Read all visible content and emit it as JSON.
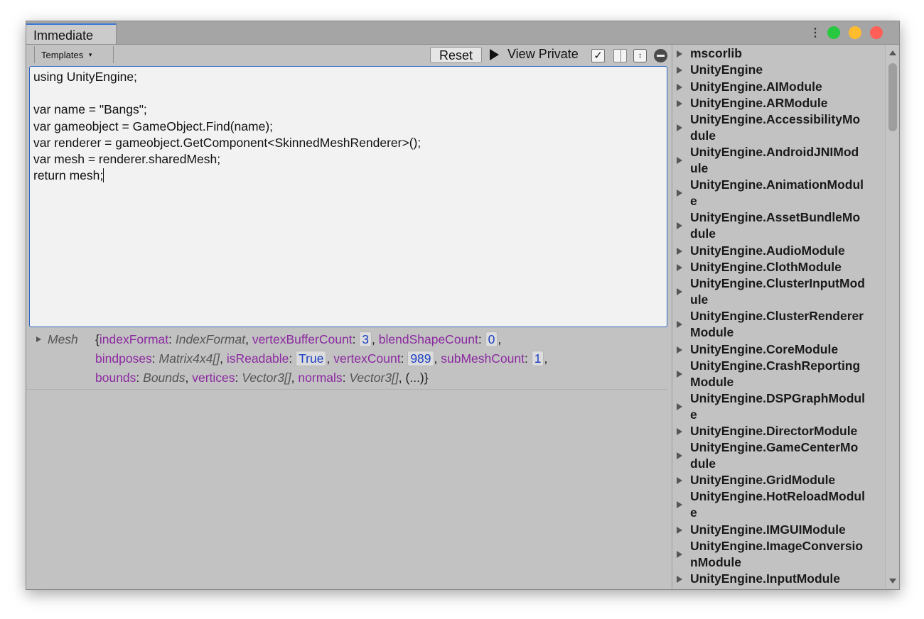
{
  "window": {
    "tab_title": "Immediate",
    "colors": {
      "close": "#ff5f57",
      "minimize": "#febc2e",
      "zoom": "#28c840",
      "accent": "#3a79d6"
    }
  },
  "toolbar": {
    "templates_label": "Templates",
    "reset_label": "Reset",
    "view_private_label": "View Private",
    "view_private_checked": true,
    "check_glyph": "✓",
    "stepper_glyph": "↕"
  },
  "editor": {
    "lines": [
      "using UnityEngine;",
      "",
      "var name = \"Bangs\";",
      "var gameobject = GameObject.Find(name);",
      "var renderer = gameobject.GetComponent<SkinnedMeshRenderer>();",
      "var mesh = renderer.sharedMesh;",
      "return mesh;"
    ]
  },
  "result": {
    "type_name": "Mesh",
    "open_brace": "{",
    "close_brace": "}",
    "ellipsis": "(...)",
    "props": {
      "indexFormat": {
        "name": "indexFormat",
        "type": "IndexFormat"
      },
      "vertexBufferCount": {
        "name": "vertexBufferCount",
        "value": "3"
      },
      "blendShapeCount": {
        "name": "blendShapeCount",
        "value": "0"
      },
      "bindposes": {
        "name": "bindposes",
        "type": "Matrix4x4[]"
      },
      "isReadable": {
        "name": "isReadable",
        "value": "True"
      },
      "vertexCount": {
        "name": "vertexCount",
        "value": "989"
      },
      "subMeshCount": {
        "name": "subMeshCount",
        "value": "1"
      },
      "bounds": {
        "name": "bounds",
        "type": "Bounds"
      },
      "vertices": {
        "name": "vertices",
        "type": "Vector3[]"
      },
      "normals": {
        "name": "normals",
        "type": "Vector3[]"
      }
    }
  },
  "assemblies": {
    "items": [
      {
        "l1": "mscorlib",
        "l2": ""
      },
      {
        "l1": "UnityEngine",
        "l2": ""
      },
      {
        "l1": "UnityEngine.AIModule",
        "l2": ""
      },
      {
        "l1": "UnityEngine.ARModule",
        "l2": ""
      },
      {
        "l1": "UnityEngine.AccessibilityMo",
        "l2": "dule"
      },
      {
        "l1": "UnityEngine.AndroidJNIMod",
        "l2": "ule"
      },
      {
        "l1": "UnityEngine.AnimationModul",
        "l2": "e"
      },
      {
        "l1": "UnityEngine.AssetBundleMo",
        "l2": "dule"
      },
      {
        "l1": "UnityEngine.AudioModule",
        "l2": ""
      },
      {
        "l1": "UnityEngine.ClothModule",
        "l2": ""
      },
      {
        "l1": "UnityEngine.ClusterInputMod",
        "l2": "ule"
      },
      {
        "l1": "UnityEngine.ClusterRenderer",
        "l2": "Module"
      },
      {
        "l1": "UnityEngine.CoreModule",
        "l2": ""
      },
      {
        "l1": "UnityEngine.CrashReporting",
        "l2": "Module"
      },
      {
        "l1": "UnityEngine.DSPGraphModul",
        "l2": "e"
      },
      {
        "l1": "UnityEngine.DirectorModule",
        "l2": ""
      },
      {
        "l1": "UnityEngine.GameCenterMo",
        "l2": "dule"
      },
      {
        "l1": "UnityEngine.GridModule",
        "l2": ""
      },
      {
        "l1": "UnityEngine.HotReloadModul",
        "l2": "e"
      },
      {
        "l1": "UnityEngine.IMGUIModule",
        "l2": ""
      },
      {
        "l1": "UnityEngine.ImageConversio",
        "l2": "nModule"
      },
      {
        "l1": "UnityEngine.InputModule",
        "l2": ""
      }
    ]
  }
}
